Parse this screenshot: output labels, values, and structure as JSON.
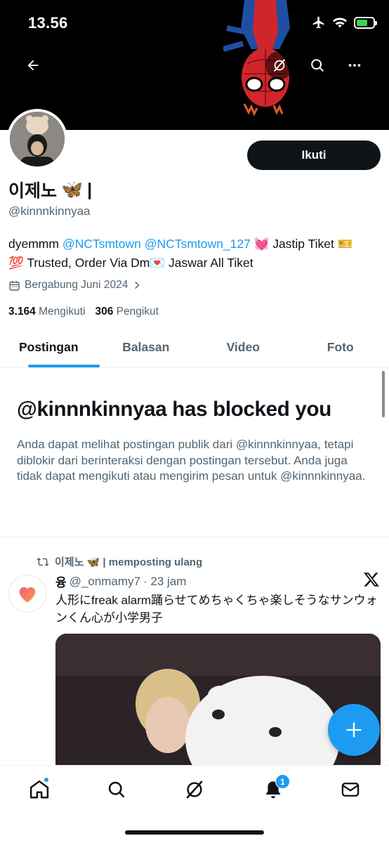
{
  "status_bar": {
    "time": "13.56"
  },
  "header_actions": {
    "back": "back-arrow-icon",
    "grok": "grok-icon",
    "search": "search-icon",
    "more": "more-icon"
  },
  "profile": {
    "display_name": "이제노",
    "name_emoji": "🦋",
    "name_suffix": "|",
    "handle": "@kinnnkinnyaa",
    "follow_label": "Ikuti",
    "bio": {
      "part1": "dyemmm ",
      "mention1": "@NCTsmtown",
      "mention2": "@NCTsmtown_127",
      "part2": " 💓 Jastip Tiket 🎫",
      "part3": "💯 Trusted, Order Via Dm💌 Jaswar All Tiket"
    },
    "joined": "Bergabung Juni 2024",
    "following_count": "3.164",
    "following_label": "Mengikuti",
    "followers_count": "306",
    "followers_label": "Pengikut"
  },
  "tabs": [
    {
      "label": "Postingan",
      "active": true
    },
    {
      "label": "Balasan",
      "active": false
    },
    {
      "label": "Video",
      "active": false
    },
    {
      "label": "Foto",
      "active": false
    }
  ],
  "blocked": {
    "title": "@kinnnkinnyaa has blocked you",
    "text": "Anda dapat melihat postingan publik dari @kinnnkinnyaa, tetapi diblokir dari berinteraksi dengan postingan tersebut. Anda juga tidak dapat mengikuti atau mengirim pesan untuk @kinnnkinnyaa."
  },
  "tweet": {
    "repost_by": "이제노 🦋 | memposting ulang",
    "author_name": "융",
    "author_handle": "@_onmamy7",
    "time": "· 23 jam",
    "text": "人形にfreak alarm踊らせてめちゃくちゃ楽しそうなサンウォンくん心が小学男子"
  },
  "nav": {
    "items": [
      "home-icon",
      "search-icon",
      "grok-icon",
      "notifications-icon",
      "messages-icon"
    ],
    "notification_badge": "1"
  },
  "colors": {
    "accent": "#1d9bf0",
    "text": "#0f1419",
    "secondary": "#536471"
  }
}
